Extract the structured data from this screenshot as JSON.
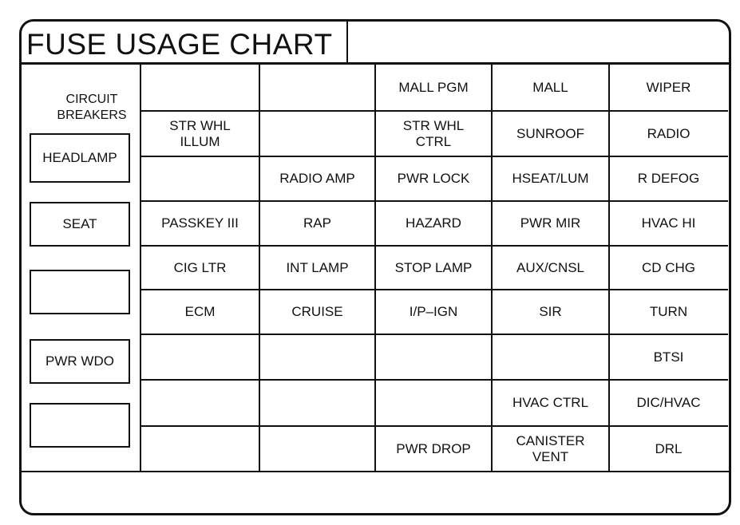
{
  "title": "FUSE USAGE CHART",
  "circuit_breakers": {
    "label_line1": "CIRCUIT",
    "label_line2": "BREAKERS",
    "boxes": [
      "HEADLAMP",
      "SEAT",
      "",
      "PWR WDO",
      ""
    ]
  },
  "fuse_grid": {
    "rows": [
      [
        "",
        "",
        "MALL PGM",
        "MALL",
        "WIPER"
      ],
      [
        "STR WHL\nILLUM",
        "",
        "STR WHL\nCTRL",
        "SUNROOF",
        "RADIO"
      ],
      [
        "",
        "RADIO AMP",
        "PWR LOCK",
        "HSEAT/LUM",
        "R DEFOG"
      ],
      [
        "PASSKEY III",
        "RAP",
        "HAZARD",
        "PWR MIR",
        "HVAC HI"
      ],
      [
        "CIG LTR",
        "INT LAMP",
        "STOP LAMP",
        "AUX/CNSL",
        "CD CHG"
      ],
      [
        "ECM",
        "CRUISE",
        "I/P–IGN",
        "SIR",
        "TURN"
      ],
      [
        "",
        "",
        "",
        "",
        "BTSI"
      ],
      [
        "",
        "",
        "",
        "HVAC CTRL",
        "DIC/HVAC"
      ],
      [
        "",
        "",
        "PWR DROP",
        "CANISTER\nVENT",
        "DRL"
      ]
    ]
  }
}
